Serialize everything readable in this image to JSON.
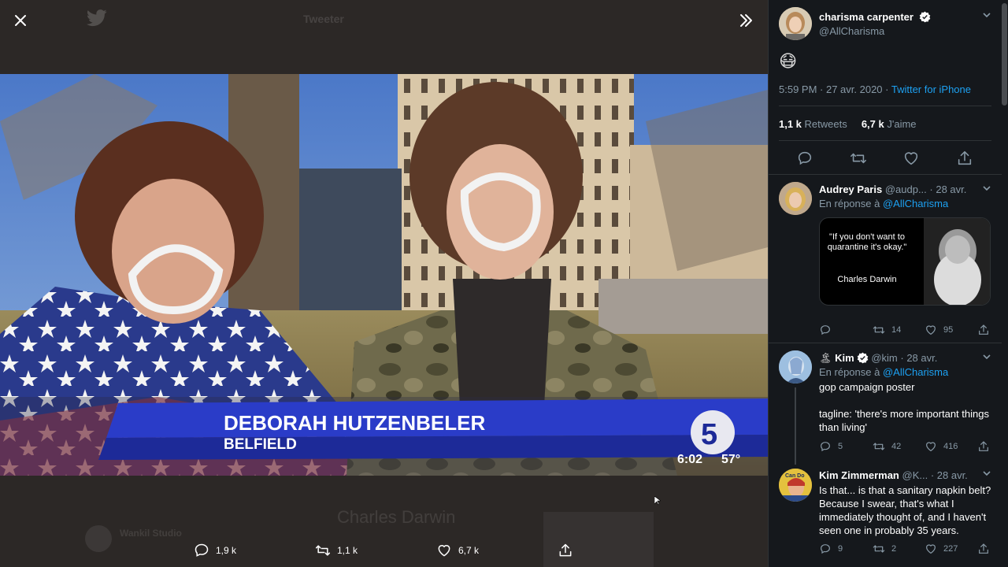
{
  "viewer": {
    "ghost_brand": "Tweeter",
    "ghost_caption": "Charles Darwin",
    "ghost_source": "Wankil Studio",
    "chyron": {
      "name": "DEBORAH HUTZENBELER",
      "location": "BELFIELD",
      "time": "6:02",
      "temp": "57°",
      "channel": "5"
    },
    "actions": {
      "replies": "1,9 k",
      "retweets": "1,1 k",
      "likes": "6,7 k"
    }
  },
  "main_tweet": {
    "name": "charisma carpenter",
    "handle": "@AllCharisma",
    "emoji": "😷",
    "time": "5:59 PM · 27 avr. 2020 · ",
    "source": "Twitter for iPhone",
    "retweets_count": "1,1 k",
    "retweets_label": "Retweets",
    "likes_count": "6,7 k",
    "likes_label": "J'aime"
  },
  "replies": [
    {
      "name": "Audrey Paris",
      "handle": "@audp...",
      "date": "· 28 avr.",
      "reply_to_label": "En réponse à ",
      "reply_to": "@AllCharisma",
      "quote_text": "\"If you don't want to quarantine it's okay.\"",
      "quote_author": "Charles Darwin",
      "retweets": "14",
      "likes": "95"
    },
    {
      "name": "Kim",
      "name_emoji": "🏝",
      "handle": "@kim",
      "date": "· 28 avr.",
      "reply_to_label": "En réponse à ",
      "reply_to": "@AllCharisma",
      "text": "gop campaign poster\n\ntagline: 'there's more important things than living'",
      "replies": "5",
      "retweets": "42",
      "likes": "416"
    },
    {
      "name": "Kim Zimmerman",
      "handle": "@K...",
      "date": "· 28 avr.",
      "avatar_text": "Can Do",
      "text": "Is that... is that a sanitary napkin belt? Because I swear, that's what I immediately thought of, and I haven't seen one in probably 35 years.",
      "replies": "9",
      "retweets": "2",
      "likes": "227"
    }
  ],
  "colors": {
    "accent": "#1da1f2",
    "background": "#15181c",
    "viewer_bg": "#2c2826",
    "chyron_blue": "#2a3cc8"
  }
}
